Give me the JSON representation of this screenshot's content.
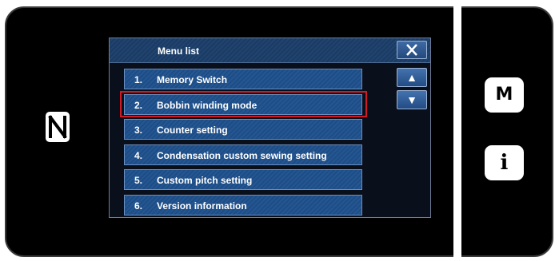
{
  "screen": {
    "title": "Menu list",
    "close_icon": "close-icon"
  },
  "menu": {
    "items": [
      {
        "number": "1.",
        "label": "Memory Switch"
      },
      {
        "number": "2.",
        "label": "Bobbin winding mode"
      },
      {
        "number": "3.",
        "label": "Counter setting"
      },
      {
        "number": "4.",
        "label": "Condensation custom sewing setting"
      },
      {
        "number": "5.",
        "label": "Custom pitch setting"
      },
      {
        "number": "6.",
        "label": "Version information"
      }
    ],
    "highlighted_item": "2."
  },
  "scroll": {
    "up": "▲",
    "down": "▼"
  },
  "side_buttons": {
    "m_label": "M",
    "info_label": "i"
  },
  "colors": {
    "highlight": "#d01b25",
    "button_blue": "#1e4c86"
  }
}
